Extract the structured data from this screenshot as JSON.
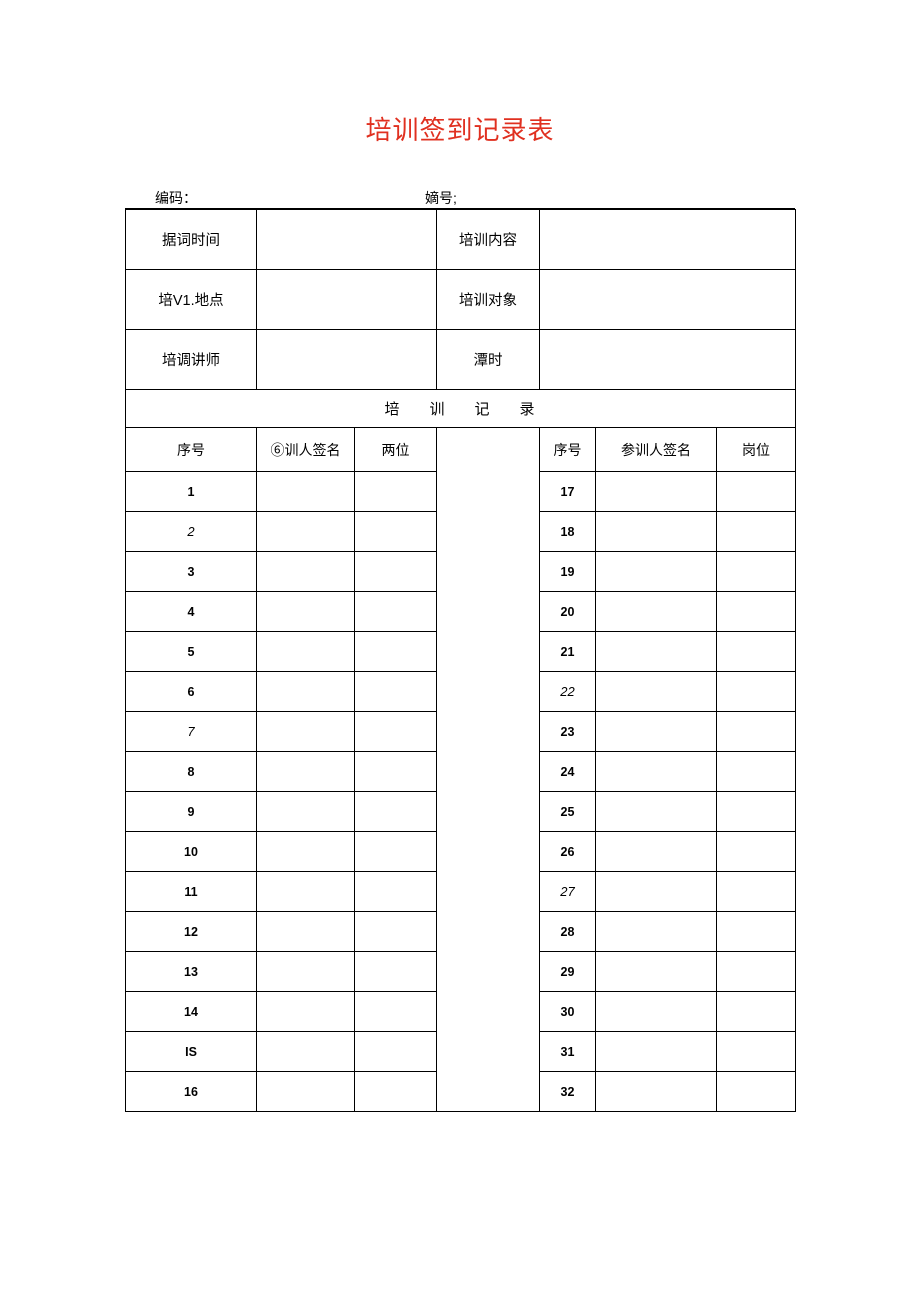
{
  "title": "培训签到记录表",
  "meta": {
    "code_label": "编码：",
    "serial_label": "嫡号;"
  },
  "info": {
    "row1_l": "据词时间",
    "row1_r": "培训内容",
    "row2_l": "培V1.地点",
    "row2_r": "培训对象",
    "row3_l": "培调讲师",
    "row3_r": "潭时"
  },
  "section_header": "培训记录",
  "cols": {
    "l_no": "序号",
    "l_sign": "⑥训人签名",
    "l_pos": "两位",
    "r_no": "序号",
    "r_sign": "参训人签名",
    "r_pos": "岗位"
  },
  "left_rows": [
    {
      "n": "1",
      "s": "bold"
    },
    {
      "n": "2",
      "s": "italic"
    },
    {
      "n": "3",
      "s": "bold"
    },
    {
      "n": "4",
      "s": "bold"
    },
    {
      "n": "5",
      "s": "bold"
    },
    {
      "n": "6",
      "s": "bold"
    },
    {
      "n": "7",
      "s": "italic"
    },
    {
      "n": "8",
      "s": "bold"
    },
    {
      "n": "9",
      "s": "bold"
    },
    {
      "n": "10",
      "s": "bold"
    },
    {
      "n": "11",
      "s": "bold"
    },
    {
      "n": "12",
      "s": "bold"
    },
    {
      "n": "13",
      "s": "bold"
    },
    {
      "n": "14",
      "s": "bold"
    },
    {
      "n": "IS",
      "s": "bold"
    },
    {
      "n": "16",
      "s": "bold"
    }
  ],
  "right_rows": [
    {
      "n": "17",
      "s": "bold"
    },
    {
      "n": "18",
      "s": "bold"
    },
    {
      "n": "19",
      "s": "bold"
    },
    {
      "n": "20",
      "s": "bold"
    },
    {
      "n": "21",
      "s": "bold"
    },
    {
      "n": "22",
      "s": "italic"
    },
    {
      "n": "23",
      "s": "bold"
    },
    {
      "n": "24",
      "s": "bold"
    },
    {
      "n": "25",
      "s": "bold"
    },
    {
      "n": "26",
      "s": "bold"
    },
    {
      "n": "27",
      "s": "italic"
    },
    {
      "n": "28",
      "s": "bold"
    },
    {
      "n": "29",
      "s": "bold"
    },
    {
      "n": "30",
      "s": "bold"
    },
    {
      "n": "31",
      "s": "bold"
    },
    {
      "n": "32",
      "s": "bold"
    }
  ]
}
